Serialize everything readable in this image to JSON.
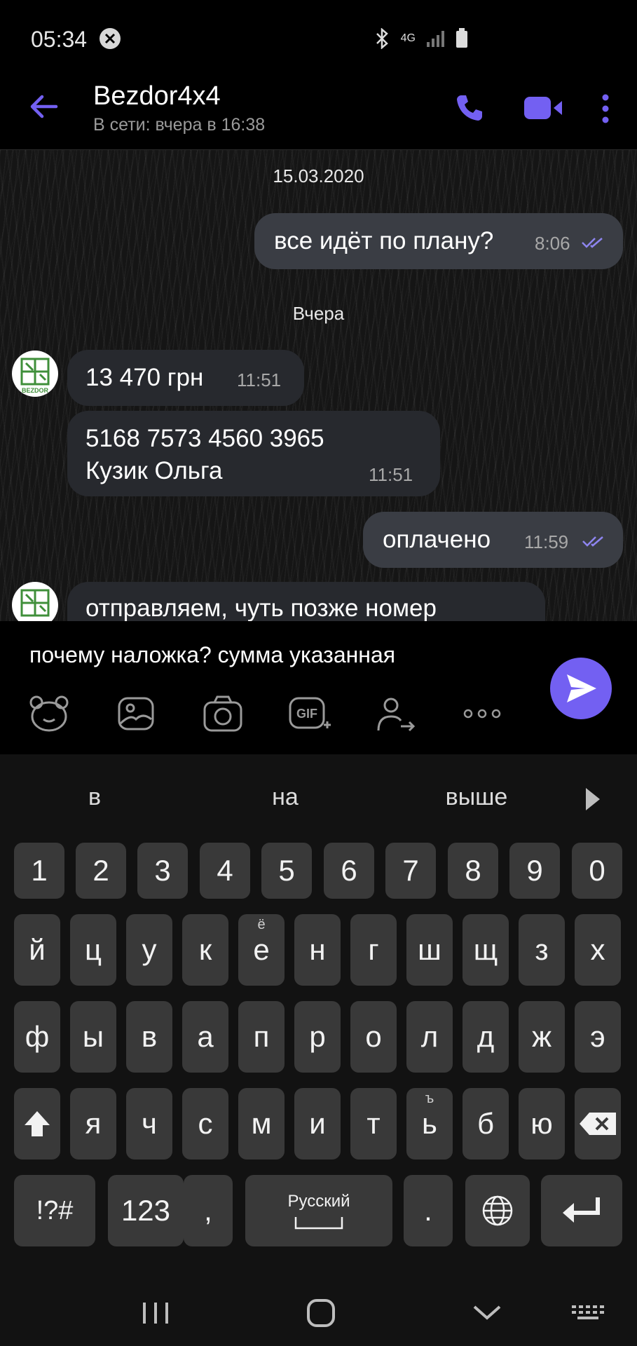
{
  "status": {
    "time": "05:34",
    "network": "4G"
  },
  "header": {
    "title": "Bezdor4x4",
    "subtitle": "В сети: вчера в 16:38"
  },
  "messages": {
    "date1": "15.03.2020",
    "m1": {
      "text": "все идёт по плану?",
      "time": "8:06"
    },
    "date2": "Вчера",
    "m2": {
      "text": "13 470 грн",
      "time": "11:51"
    },
    "m3": {
      "line1": "5168 7573 4560 3965",
      "line2": "Кузик Ольга",
      "time": "11:51"
    },
    "m4": {
      "text": "оплачено",
      "time": "11:59"
    },
    "m5": {
      "text": "отправляем, чуть позже номер"
    },
    "avatar_label": "BEZDOR"
  },
  "composer": {
    "text": "почему наложка? сумма указанная",
    "gif_label": "GIF"
  },
  "keyboard": {
    "suggestions": [
      "в",
      "на",
      "выше"
    ],
    "row_numbers": [
      "1",
      "2",
      "3",
      "4",
      "5",
      "6",
      "7",
      "8",
      "9",
      "0"
    ],
    "row1": [
      "й",
      "ц",
      "у",
      "к",
      "е",
      "н",
      "г",
      "ш",
      "щ",
      "з",
      "х"
    ],
    "row1_sup_e": "ё",
    "row2": [
      "ф",
      "ы",
      "в",
      "а",
      "п",
      "р",
      "о",
      "л",
      "д",
      "ж",
      "э"
    ],
    "row3": [
      "я",
      "ч",
      "с",
      "м",
      "и",
      "т",
      "ь",
      "б",
      "ю"
    ],
    "row3_sup_soft": "ъ",
    "sym": "!?#",
    "num": "123",
    "comma": ",",
    "space": "Русский",
    "period": "."
  },
  "colors": {
    "accent": "#7360f2",
    "bubble_out": "#3a3d44",
    "bubble_in": "#27292e",
    "key": "#393939"
  }
}
